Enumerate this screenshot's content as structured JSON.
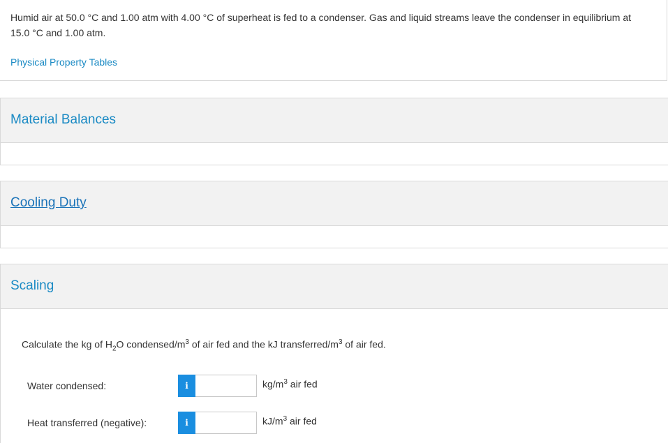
{
  "problem": {
    "text": "Humid air at 50.0 °C and 1.00 atm with 4.00 °C of superheat is fed to a condenser. Gas and liquid streams leave the condenser in equilibrium at 15.0 °C and 1.00 atm.",
    "link": "Physical Property Tables"
  },
  "parts": [
    {
      "title": "Material Balances"
    },
    {
      "title": "Cooling Duty"
    },
    {
      "title": "Scaling"
    }
  ],
  "scaling": {
    "question": {
      "pre": "Calculate the kg of H",
      "sub": "2",
      "mid": "O condensed/m",
      "sup1": "3",
      "mid2": " of air fed and the kJ transferred/m",
      "sup2": "3",
      "post": " of air fed."
    },
    "rows": [
      {
        "label": "Water condensed:",
        "info": "i",
        "value": "",
        "unit_pre": "kg/m",
        "unit_sup": "3",
        "unit_post": " air fed"
      },
      {
        "label": "Heat transferred (negative):",
        "info": "i",
        "value": "",
        "unit_pre": "kJ/m",
        "unit_sup": "3",
        "unit_post": " air fed"
      }
    ]
  },
  "colors": {
    "link": "#1a8ac4",
    "info_button": "#1a8ee0",
    "header_bg": "#f2f2f2"
  }
}
